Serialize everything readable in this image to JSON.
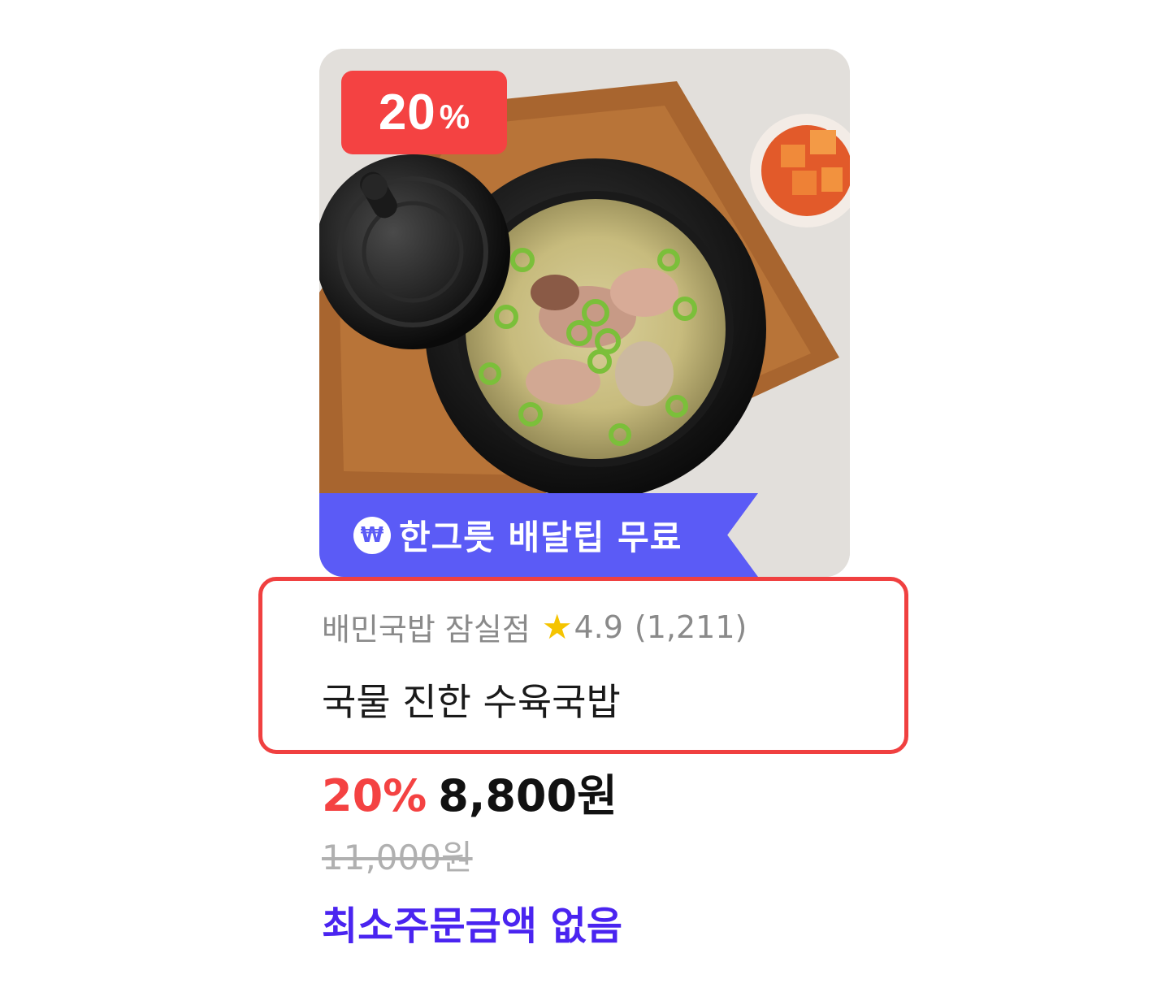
{
  "product": {
    "discount_badge": {
      "number": "20",
      "symbol": "%"
    },
    "delivery_ribbon": {
      "icon": "won-coin-icon",
      "text": "한그릇 배달팁 무료"
    },
    "store": {
      "name": "배민국밥 잠실점",
      "star_icon": "★",
      "rating": "4.9",
      "review_count": "(1,211)"
    },
    "menu_name": "국물 진한 수육국밥",
    "price": {
      "discount_percent": "20%",
      "sale_price": "8,800원",
      "original_price": "11,000원"
    },
    "min_order": "최소주문금액 없음"
  },
  "colors": {
    "discount_red": "#f44242",
    "ribbon_purple": "#5b5bf6",
    "highlight_border": "#f04040",
    "min_order_text": "#4a24f0",
    "star": "#f5c400"
  }
}
